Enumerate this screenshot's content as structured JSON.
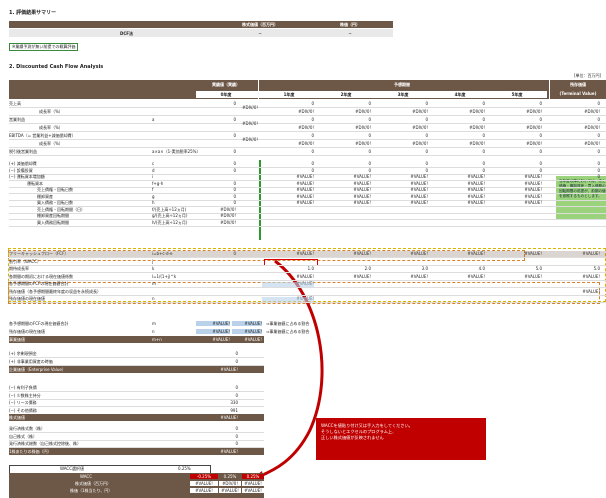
{
  "section1": {
    "title": "1. 評価結果サマリー",
    "col_headers": [
      "株式価値（百万円）",
      "株価（円）"
    ],
    "row_label": "DCF法",
    "row_values": [
      "~",
      "~"
    ],
    "note": "※業績予測が無い前提での概算評価"
  },
  "section2": {
    "title": "2. Discounted Cash Flow Analysis",
    "unit": "[単位：百万円]",
    "hdr_left": "実績値（実績）",
    "hdr_forecast": "予想期間",
    "hdr_terminal": "残存価値",
    "hdr_terminal_sub": "(Terminal Value)",
    "periods": [
      "0年度",
      "1年度",
      "2年度",
      "3年度",
      "4年度",
      "5年度"
    ]
  },
  "pl_rows": [
    {
      "label": "売上高",
      "sym": "",
      "v0": "0",
      "v0b": "#DIV/0!",
      "vals": [
        "0",
        "0",
        "0",
        "0",
        "0"
      ],
      "tv": "0"
    },
    {
      "label": "成長率（%）",
      "sym": "",
      "v0": "",
      "v0b": "",
      "vals": [
        "#DIV/0!",
        "#DIV/0!",
        "#DIV/0!",
        "#DIV/0!",
        "#DIV/0!"
      ],
      "tv": "#DIV/0!"
    },
    {
      "label": "営業利益",
      "sym": "a",
      "v0": "0",
      "v0b": "#DIV/0!",
      "vals": [
        "0",
        "0",
        "0",
        "0",
        "0"
      ],
      "tv": "0"
    },
    {
      "label": "成長率（%）",
      "sym": "",
      "v0": "",
      "v0b": "",
      "vals": [
        "#DIV/0!",
        "#DIV/0!",
        "#DIV/0!",
        "#DIV/0!",
        "#DIV/0!"
      ],
      "tv": "#DIV/0!"
    },
    {
      "label": "EBITDA（= 営業利益+減価償却費）",
      "sym": "",
      "v0": "0",
      "v0b": "#DIV/0!",
      "vals": [
        "0",
        "0",
        "0",
        "0",
        "0"
      ],
      "tv": "0"
    },
    {
      "label": "成長率（%）",
      "sym": "",
      "v0": "",
      "v0b": "",
      "vals": [
        "#DIV/0!",
        "#DIV/0!",
        "#DIV/0!",
        "#DIV/0!",
        "#DIV/0!"
      ],
      "tv": "#DIV/0!"
    },
    {
      "label": "税引後営業利益",
      "sym": "a×a×（1-実効税率25%）",
      "v0": "0",
      "v0b": "",
      "vals": [
        "0",
        "0",
        "0",
        "0",
        "0"
      ],
      "tv": "0"
    }
  ],
  "adj_rows": [
    {
      "label": "(+) 減価償却費",
      "sym": "c",
      "v0": "0",
      "vals": [
        "0",
        "0",
        "0",
        "0",
        "0"
      ],
      "tv": "0"
    },
    {
      "label": "(−) 設備投資",
      "sym": "d",
      "v0": "0",
      "vals": [
        "0",
        "0",
        "0",
        "0",
        "0"
      ],
      "tv": "0"
    },
    {
      "label": "(−) 運転資本増加額",
      "sym": "i",
      "v0": "",
      "vals": [
        "#VALUE!",
        "#VALUE!",
        "#VALUE!",
        "#VALUE!",
        "#VALUE!"
      ],
      "tv": "0"
    },
    {
      "label": "運転資本",
      "sym": "f+g-h",
      "v0": "0",
      "vals": [
        "#VALUE!",
        "#VALUE!",
        "#VALUE!",
        "#VALUE!",
        "#VALUE!"
      ],
      "tv": ""
    },
    {
      "label": "売上債権・回転日数",
      "sym": "f",
      "v0": "0",
      "vals": [
        "#VALUE!",
        "#VALUE!",
        "#VALUE!",
        "#VALUE!",
        "#VALUE!"
      ],
      "tv": ""
    },
    {
      "label": "棚卸資産",
      "sym": "g",
      "v0": "0",
      "vals": [
        "#VALUE!",
        "#VALUE!",
        "#VALUE!",
        "#VALUE!",
        "#VALUE!"
      ],
      "tv": ""
    },
    {
      "label": "買入債務・回転日数",
      "sym": "h",
      "v0": "0",
      "vals": [
        "#VALUE!",
        "#VALUE!",
        "#VALUE!",
        "#VALUE!",
        "#VALUE!"
      ],
      "tv": ""
    },
    {
      "label": "売上債権・回転期間（日）",
      "sym": "f/(売上高÷12ヵ月)",
      "v0": "#DIV/0!",
      "vals": [
        "",
        "",
        "",
        "",
        ""
      ],
      "tv": ""
    },
    {
      "label": "棚卸資産回転期間",
      "sym": "g/(売上高÷12ヵ月)",
      "v0": "#DIV/0!",
      "vals": [
        "",
        "",
        "",
        "",
        ""
      ],
      "tv": ""
    },
    {
      "label": "買入債務回転期間",
      "sym": "h/(売上高÷12ヵ月)",
      "v0": "#DIV/0!",
      "vals": [
        "",
        "",
        "",
        "",
        ""
      ],
      "tv": ""
    }
  ],
  "callout_green": "当年度以降においては、売上債権・棚卸資産・買入債務の回転期間の前提が、前期の値を参照するものとします。",
  "fcf_rows": [
    {
      "label": "フリーキャッシュフロー（FCF）",
      "sym": "i=b+c-d-e",
      "v0": "0",
      "vals": [
        "#VALUE!",
        "#VALUE!",
        "#VALUE!",
        "#VALUE!",
        "#VALUE!"
      ],
      "tv": "#VALUE!"
    },
    {
      "label": "割引率（WACC）",
      "sym": "j",
      "v0": "",
      "vals": [
        "",
        "",
        "",
        "",
        ""
      ],
      "tv": ""
    },
    {
      "label": "期待成長率",
      "sym": "k",
      "v0": "",
      "vals": [
        "1.0",
        "2.0",
        "3.0",
        "4.0",
        "5.0"
      ],
      "tv": "5.0"
    },
    {
      "label": "各期間の期初における現在価値係数",
      "sym": "l=1/(1+j)^k",
      "v0": "",
      "vals": [
        "#VALUE!",
        "#VALUE!",
        "#VALUE!",
        "#VALUE!",
        "#VALUE!"
      ],
      "tv": "#VALUE!"
    },
    {
      "label": "各予想期間のFCFの現在価値合計",
      "sym": "m",
      "v0": "",
      "vals": [
        "#VALUE!",
        "",
        "",
        "",
        ""
      ],
      "tv": ""
    },
    {
      "label": "残存価値（各予想期間最終年度の収益を永続成長）",
      "sym": "",
      "v0": "",
      "vals": [
        "",
        "",
        "",
        "",
        ""
      ],
      "tv": "#VALUE!"
    },
    {
      "label": "残存価値の現在価値",
      "sym": "n",
      "v0": "",
      "vals": [
        "#VALUE!",
        "",
        "",
        "",
        ""
      ],
      "tv": ""
    }
  ],
  "sum_rows": [
    {
      "label": "各予想期間のFCFの現在価値合計",
      "sym": "m",
      "a": "#VALUE!",
      "b": "#VALUE!",
      "note": "⇒事業価値に占める割合"
    },
    {
      "label": "残存価値の現在価値",
      "sym": "n",
      "a": "#VALUE!",
      "b": "#VALUE!",
      "note": "⇒事業価値に占める割合"
    },
    {
      "label": "事業価値",
      "sym": "m+n",
      "a": "#VALUE!",
      "b": "#VALUE!",
      "note": ""
    }
  ],
  "ev_rows": [
    {
      "label": "(+) 余剰現預金",
      "v": "0"
    },
    {
      "label": "(+) 非事業用資産の時価",
      "v": "0"
    },
    {
      "label": "企業価値（Enterprise Value）",
      "v": "#VALUE!"
    }
  ],
  "debt_rows": [
    {
      "label": "(−) 有利子負債",
      "v": "0"
    },
    {
      "label": "(−) 少数株主持分",
      "v": "0"
    },
    {
      "label": "(−) リース債務",
      "v": "330"
    },
    {
      "label": "(−) その他債務",
      "v": "991"
    },
    {
      "label": "株式価値",
      "v": "#VALUE!"
    }
  ],
  "share_rows": [
    {
      "label": "発行済株式数（株）",
      "v": "0"
    },
    {
      "label": "自己株式（株）",
      "v": "0"
    },
    {
      "label": "発行済株式総数（自己株式控除後、株）",
      "v": "0"
    },
    {
      "label": "1株あたりの株価（円）",
      "v": "#VALUE!"
    }
  ],
  "red_note": "WACCを値貼り付け又は手入力をしてください。\nそうしないとエクセルのプログラム上、\n正しい株式価値が反映されません",
  "sens": {
    "header_label": "WACC選択値",
    "header_value": "0.25%",
    "row_wacc_label": "WACC",
    "cols": [
      "-0.25%",
      "0.25%",
      "0.25%"
    ],
    "row1_label": "株式価値（百万円）",
    "row1": [
      "#VALUE!",
      "#DIV/0!",
      "#VALUE!"
    ],
    "row2_label": "株価（1株当たり、円）",
    "row2": [
      "#VALUE!",
      "#VALUE!",
      "#VALUE!"
    ]
  }
}
